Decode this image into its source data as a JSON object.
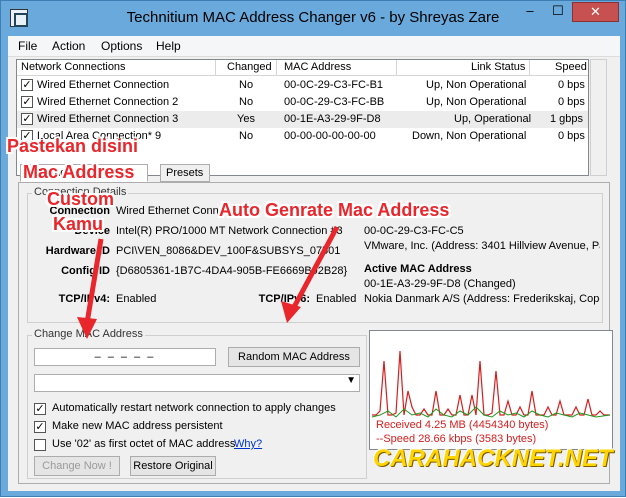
{
  "window": {
    "title": "Technitium MAC Address Changer v6 - by Shreyas Zare",
    "minimize": "–",
    "maximize": "☐",
    "close": "✕"
  },
  "menu": [
    "File",
    "Action",
    "Options",
    "Help"
  ],
  "grid": {
    "headers": [
      "Network Connections",
      "Changed",
      "MAC Address",
      "Link Status",
      "Speed"
    ],
    "rows": [
      {
        "name": "Wired Ethernet Connection",
        "changed": "No",
        "mac": "00-0C-29-C3-FC-B1",
        "status": "Up, Non Operational",
        "speed": "0 bps",
        "checked": true
      },
      {
        "name": "Wired Ethernet Connection 2",
        "changed": "No",
        "mac": "00-0C-29-C3-FC-BB",
        "status": "Up, Non Operational",
        "speed": "0 bps",
        "checked": true
      },
      {
        "name": "Wired Ethernet Connection 3",
        "changed": "Yes",
        "mac": "00-1E-A3-29-9F-D8",
        "status": "Up, Operational",
        "speed": "1 gbps",
        "checked": true
      },
      {
        "name": "Local Area Connection* 9",
        "changed": "No",
        "mac": "00-00-00-00-00-00",
        "status": "Down, Non Operational",
        "speed": "0 bps",
        "checked": true
      }
    ]
  },
  "tabs": {
    "tab1": "MAC Address",
    "tab2": "Presets"
  },
  "details": {
    "group": "Connection Details",
    "connection_label": "Connection",
    "connection_value": "Wired Ethernet Connec",
    "device_label": "Device",
    "device_value": "Intel(R) PRO/1000 MT Network Connection #3",
    "hwid_label": "Hardware ID",
    "hwid_value": "PCI\\VEN_8086&DEV_100F&SUBSYS_07501",
    "config_label": "Config ID",
    "config_value": "{D6805361-1B7C-4DA4-905B-FE6669B92B28}",
    "ipv4_label": "TCP/IPv4:",
    "ipv4_value": "Enabled",
    "ipv6_label": "TCP/IPv6:",
    "ipv6_value": "Enabled",
    "orig_mac": "00-0C-29-C3-FC-C5",
    "orig_vendor": "VMware, Inc.  (Address: 3401 Hillview Avenue, Pal",
    "active_label": "Active MAC Address",
    "active_mac": "00-1E-A3-29-9F-D8 (Changed)",
    "active_vendor": "Nokia Danmark A/S  (Address: Frederikskaj, Coper"
  },
  "change": {
    "group": "Change MAC Address",
    "mac_placeholder": "–   –   –   –   –",
    "random_button": "Random MAC Address",
    "option1": "Automatically restart network connection to apply changes",
    "option2": "Make new MAC address persistent",
    "option3": "Use '02' as first octet of MAC address",
    "why_link": "Why?",
    "change_button": "Change Now !",
    "restore_button": "Restore Original"
  },
  "stats": {
    "received": "Received   4.25 MB (4454340 bytes)",
    "speed": "--Speed   28.66 kbps (3583 bytes)"
  },
  "annotations": {
    "paste": "Pastekan disini",
    "mac": "Mac Address",
    "custom": "Custom",
    "kamu": "Kamu",
    "auto": "Auto Genrate Mac Address"
  },
  "watermark": "CARAHACKNET.NET",
  "colors": {
    "titlebar": "#6aa9dc",
    "close": "#c75050",
    "annotation": "#e8262b",
    "graph_red": "#d21f1f",
    "graph_green": "#1c9a1c"
  }
}
